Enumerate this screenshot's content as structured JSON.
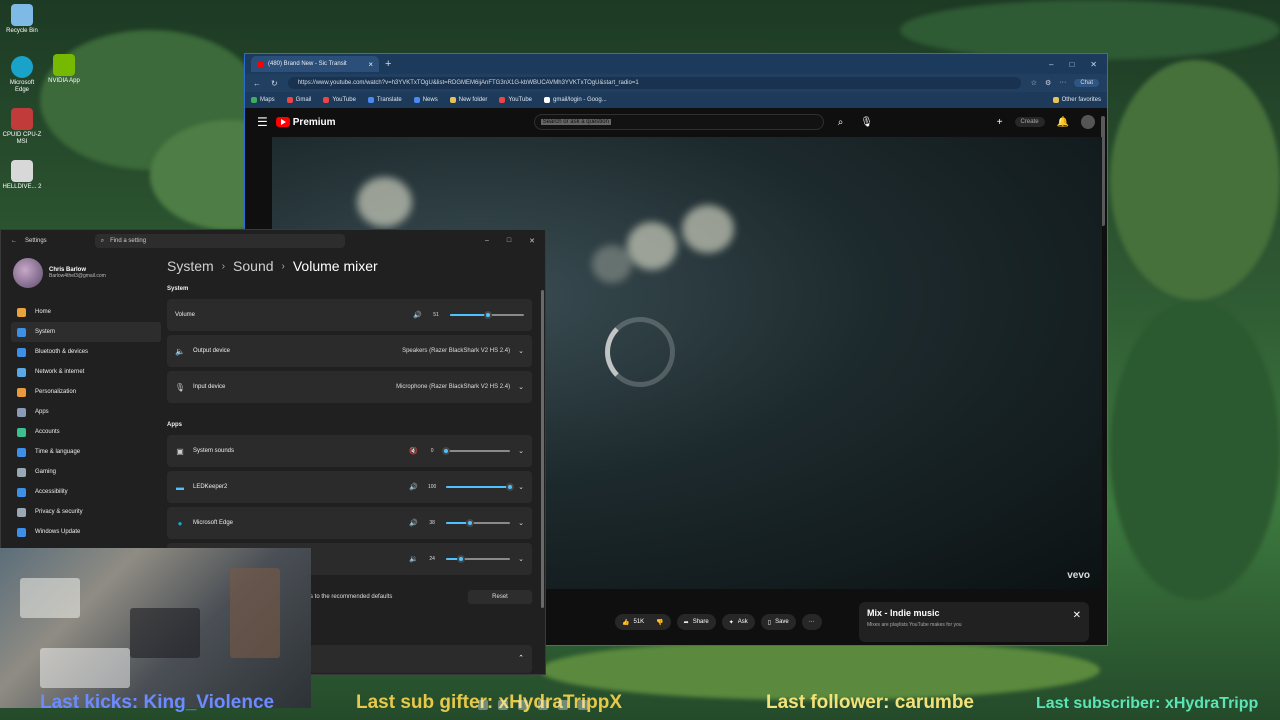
{
  "desktop": {
    "icons": [
      {
        "label": "Recycle Bin",
        "color": "#7fb9e6"
      },
      {
        "label": "Microsoft Edge",
        "color": "#1aa3c9"
      },
      {
        "label": "NVIDIA App",
        "color": "#76b900"
      },
      {
        "label": "CPUID CPU-Z MSI",
        "color": "#c23b3b"
      },
      {
        "label": "HELLDIVE... 2",
        "color": "#d8d8d8"
      },
      {
        "label": "",
        "color": "#2fbf5c"
      }
    ]
  },
  "browser": {
    "tab_title": "(480) Brand New - Sic Transit",
    "url": "https://www.youtube.com/watch?v=h3YVKTxTOgU&list=RDGMEM6ijAnFTG3nX1G-kbWBUCAVMh3YVKTxTOgU&start_radio=1",
    "chat_label": "Chat",
    "favorites": [
      "Maps",
      "Gmail",
      "YouTube",
      "Translate",
      "News",
      "New folder",
      "YouTube",
      "gmail/login - Goog..."
    ],
    "other_favorites": "Other favorites",
    "youtube": {
      "brand": "Premium",
      "search_placeholder": "Search or ask a question",
      "create_label": "Create",
      "watermark": "vevo",
      "actions": {
        "likes": "51K",
        "share": "Share",
        "ask": "Ask",
        "save": "Save",
        "more": "···"
      },
      "mix": {
        "title": "Mix - Indie music",
        "subtitle": "Mixes are playlists YouTube makes for you"
      }
    }
  },
  "settings": {
    "app_title": "Settings",
    "search_placeholder": "Find a setting",
    "user": {
      "name": "Chris Barlow",
      "email": "Barlow4thel3@gmail.com"
    },
    "nav": [
      {
        "label": "Home",
        "color": "#e8a33d"
      },
      {
        "label": "System",
        "color": "#3d8fe8"
      },
      {
        "label": "Bluetooth & devices",
        "color": "#3d8fe8"
      },
      {
        "label": "Network & internet",
        "color": "#5aa6e6"
      },
      {
        "label": "Personalization",
        "color": "#e89a3d"
      },
      {
        "label": "Apps",
        "color": "#8a9bb8"
      },
      {
        "label": "Accounts",
        "color": "#3dc08f"
      },
      {
        "label": "Time & language",
        "color": "#3d8fe8"
      },
      {
        "label": "Gaming",
        "color": "#9aa7b4"
      },
      {
        "label": "Accessibility",
        "color": "#3d8fe8"
      },
      {
        "label": "Privacy & security",
        "color": "#9aa7b4"
      },
      {
        "label": "Windows Update",
        "color": "#3d8fe8"
      }
    ],
    "active_nav": "System",
    "breadcrumb": [
      "System",
      "Sound",
      "Volume mixer"
    ],
    "system_section": "System",
    "volume": {
      "label": "Volume",
      "value": "51",
      "level": 0.51
    },
    "output": {
      "label": "Output device",
      "value": "Speakers (Razer BlackShark V2 HS 2.4)"
    },
    "input": {
      "label": "Input device",
      "value": "Microphone (Razer BlackShark V2 HS 2.4)"
    },
    "apps_section": "Apps",
    "apps": [
      {
        "label": "System sounds",
        "value": "0",
        "level": 0.0
      },
      {
        "label": "LEDKeeper2",
        "value": "100",
        "level": 1.0
      },
      {
        "label": "Microsoft Edge",
        "value": "38",
        "level": 0.38
      },
      {
        "label": "",
        "value": "24",
        "level": 0.24
      }
    ],
    "reset_text": "s to the recommended defaults",
    "reset_button": "Reset"
  },
  "overlay": {
    "kicks": "Last kicks: King_Violence",
    "gifter": "Last sub gifter: xHydraTrippX",
    "follower": "Last follower: carumbe",
    "subscriber": "Last subscriber: xHydraTripp"
  }
}
